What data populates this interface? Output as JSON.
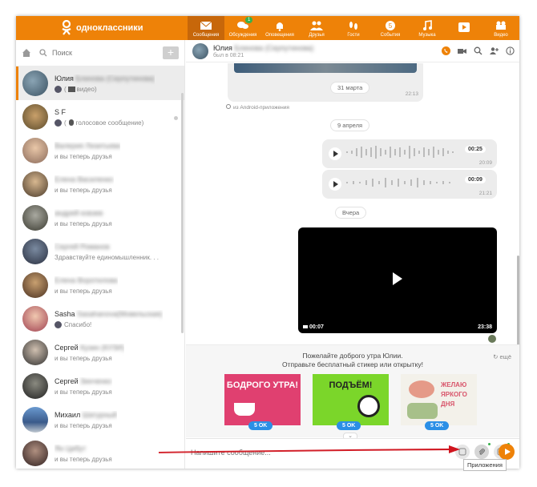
{
  "app": {
    "name": "одноклассники"
  },
  "nav": [
    {
      "label": "Сообщения",
      "icon": "envelope-icon",
      "active": true
    },
    {
      "label": "Обсуждения",
      "icon": "chat-bubbles-icon",
      "badge": "1"
    },
    {
      "label": "Оповещения",
      "icon": "bell-icon"
    },
    {
      "label": "Друзья",
      "icon": "friends-icon"
    },
    {
      "label": "Гости",
      "icon": "footprints-icon"
    },
    {
      "label": "События",
      "icon": "events-icon"
    },
    {
      "label": "Музыка",
      "icon": "music-note-icon"
    },
    {
      "label": "Видео",
      "icon": "video-camera-icon"
    }
  ],
  "sidebar": {
    "search_placeholder": "Поиск",
    "add_label": "+",
    "chats": [
      {
        "name": "Юлия",
        "name_blurred": "Блинова (Серпутинова)",
        "preview": "видео)",
        "preview_prefix": "(",
        "active": true
      },
      {
        "name": "S F",
        "name_blurred": "",
        "preview": "голосовое сообщение)",
        "preview_prefix": "("
      },
      {
        "name": "",
        "name_blurred": "Валерия Лизитьева",
        "preview": "и вы теперь друзья"
      },
      {
        "name": "",
        "name_blurred": "Елена Василенко",
        "preview": "и вы теперь друзья"
      },
      {
        "name": "",
        "name_blurred": "андрей ковзев",
        "preview": "и вы теперь друзья"
      },
      {
        "name": "",
        "name_blurred": "Сергей Романов",
        "preview": "Здравствуйте единомышленник. . ."
      },
      {
        "name": "",
        "name_blurred": "Елена Воротилова",
        "preview": "и вы теперь друзья"
      },
      {
        "name": "Sasha",
        "name_blurred": "Sasahanova(Мовельская)",
        "preview": "Спасибо!"
      },
      {
        "name": "Сергей",
        "name_blurred": "Кузин (КУЗИ)",
        "preview": "и вы теперь друзья"
      },
      {
        "name": "Сергей",
        "name_blurred": "Зинченко",
        "preview": "и вы теперь друзья"
      },
      {
        "name": "Михаил",
        "name_blurred": "Шатурный",
        "preview": "и вы теперь друзья"
      },
      {
        "name": "",
        "name_blurred": "Ян Цибут",
        "preview": "и вы теперь друзья"
      }
    ]
  },
  "chat": {
    "contact_name": "Юлия",
    "contact_name_blurred": "Блинова (Серпутинова)",
    "status": "был в 08:21",
    "photo_date": "31 марта",
    "photo_time": "22:13",
    "via": "из Android-приложения",
    "date_april": "9 апреля",
    "voice1": {
      "duration": "00:25",
      "time": "20:09"
    },
    "voice2": {
      "duration": "00:09",
      "time": "21:21"
    },
    "date_yesterday": "Вчера",
    "video": {
      "duration": "00:07",
      "time": "23:38"
    }
  },
  "suggest": {
    "text1": "Пожелайте доброго утра Юлии.",
    "text2": "Отправьте бесплатный стикер или открытку!",
    "more": "ещё",
    "stickers": [
      {
        "text": "БОДРОГО УТРА!",
        "price": "5 OK"
      },
      {
        "text": "ПОДЪЁМ!",
        "price": "5 OK"
      },
      {
        "text": "ЖЕЛАЮ ЯРКОГО ДНЯ",
        "price": "5 OK"
      }
    ]
  },
  "composer": {
    "placeholder": "Напишите сообщение...",
    "tooltip": "Приложения"
  },
  "colors": {
    "accent": "#ee8208",
    "price": "#2b8fe6",
    "online": "#38b04b",
    "arrow": "#d0141e"
  }
}
